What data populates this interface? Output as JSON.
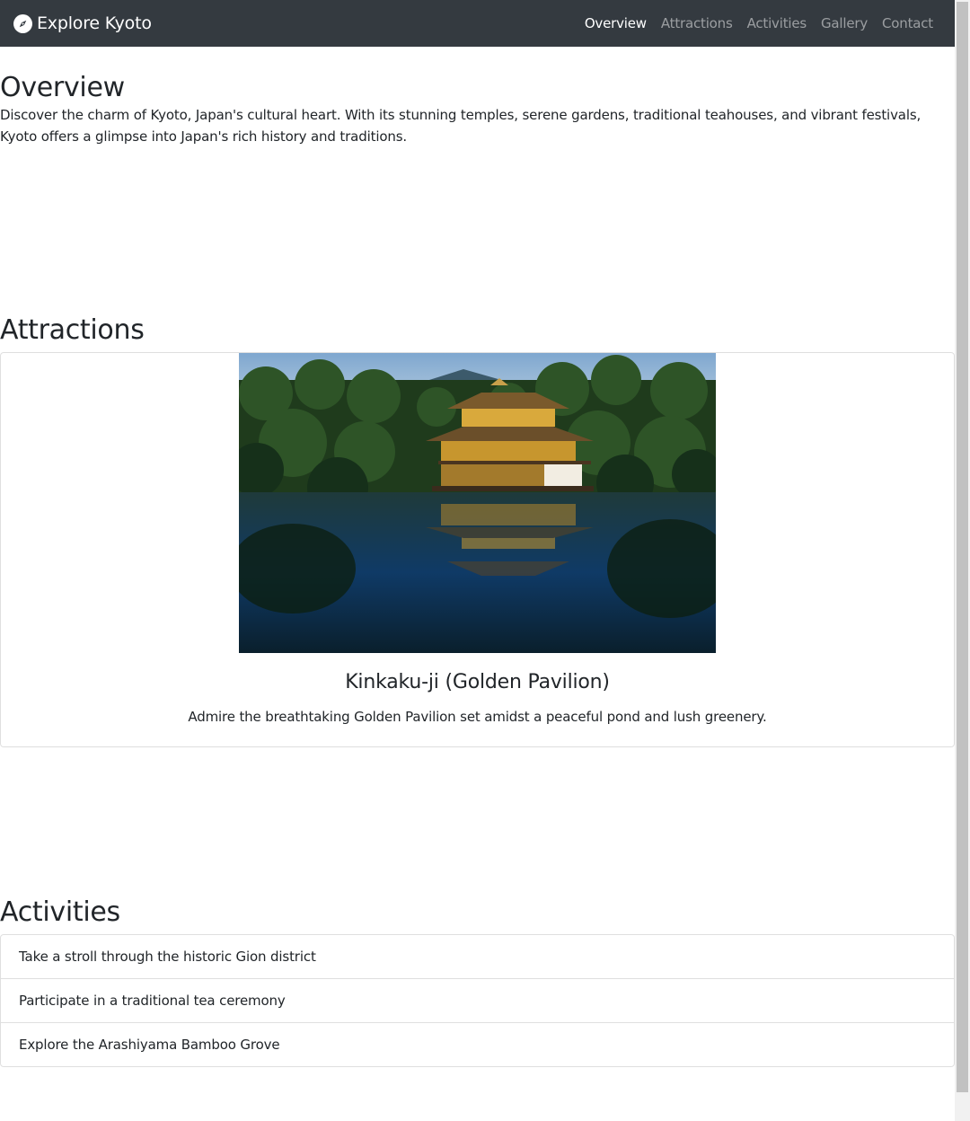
{
  "navbar": {
    "brand_icon": "compass-icon",
    "brand": "Explore Kyoto",
    "links": [
      {
        "label": "Overview",
        "active": true
      },
      {
        "label": "Attractions",
        "active": false
      },
      {
        "label": "Activities",
        "active": false
      },
      {
        "label": "Gallery",
        "active": false
      },
      {
        "label": "Contact",
        "active": false
      }
    ]
  },
  "overview": {
    "heading": "Overview",
    "text": "Discover the charm of Kyoto, Japan's cultural heart. With its stunning temples, serene gardens, traditional teahouses, and vibrant festivals, Kyoto offers a glimpse into Japan's rich history and traditions."
  },
  "attractions": {
    "heading": "Attractions",
    "card": {
      "image": "golden-pavilion-photo",
      "title": "Kinkaku-ji (Golden Pavilion)",
      "text": "Admire the breathtaking Golden Pavilion set amidst a peaceful pond and lush greenery."
    }
  },
  "activities": {
    "heading": "Activities",
    "items": [
      "Take a stroll through the historic Gion district",
      "Participate in a traditional tea ceremony",
      "Explore the Arashiyama Bamboo Grove"
    ]
  }
}
